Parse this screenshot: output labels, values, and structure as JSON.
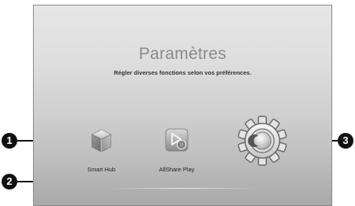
{
  "screen": {
    "title": "Paramètres",
    "subtitle": "Régler diverses fonctions selon vos préférences."
  },
  "apps": [
    {
      "label": "Smart Hub",
      "icon": "smart-hub-cube-icon"
    },
    {
      "label": "AllShare Play",
      "icon": "allshare-play-icon"
    },
    {
      "label": "",
      "icon": "settings-gear-icon"
    }
  ],
  "callouts": [
    "1",
    "2",
    "3"
  ]
}
